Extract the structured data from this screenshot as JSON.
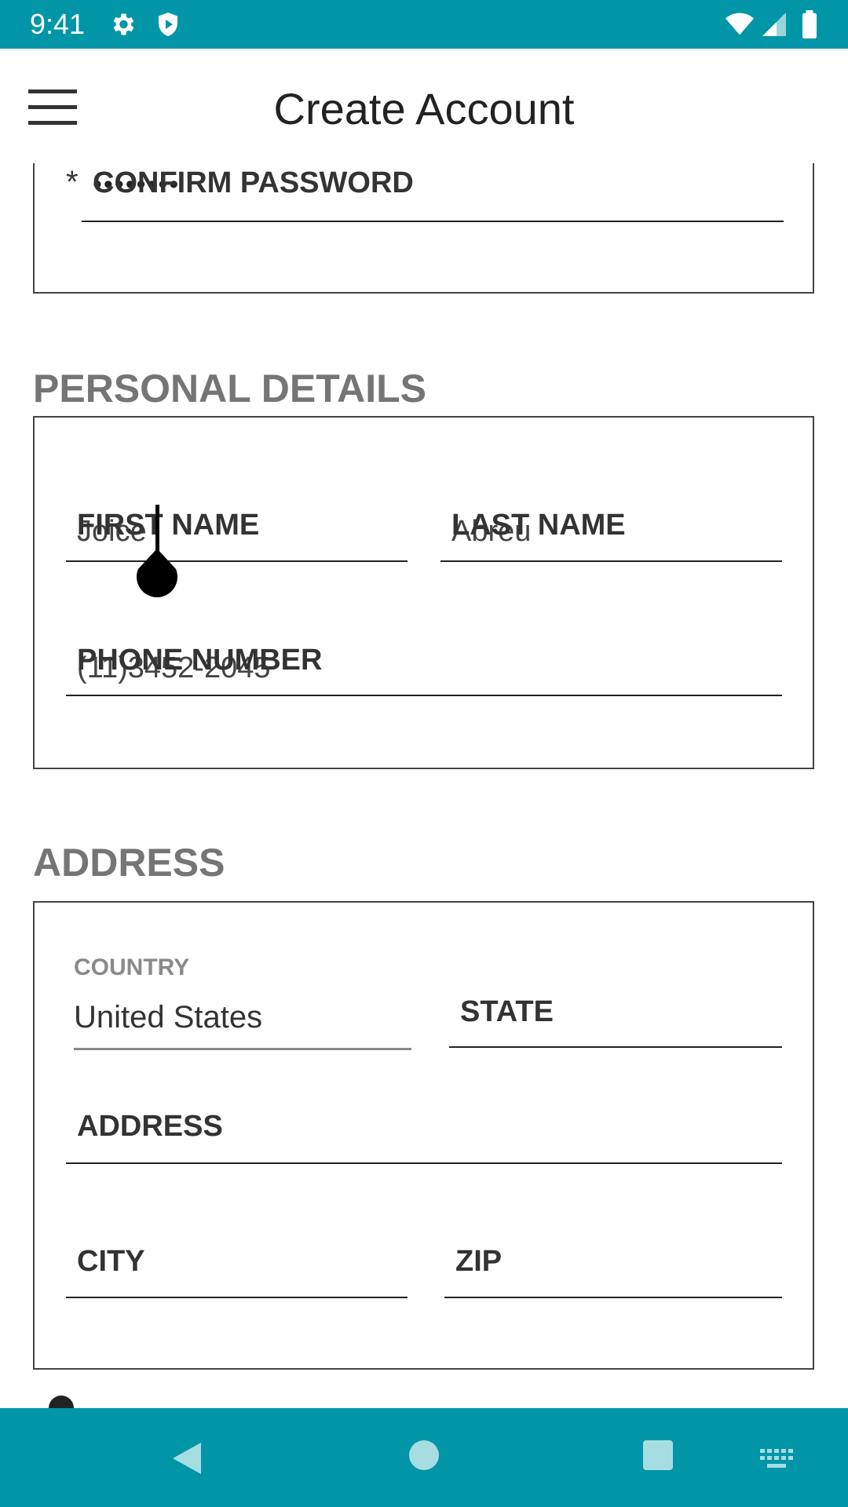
{
  "status_bar": {
    "time": "9:41",
    "icons": [
      "gear-icon",
      "shield-icon",
      "wifi-icon",
      "signal-icon",
      "battery-icon"
    ]
  },
  "app_bar": {
    "title": "Create Account",
    "menu_icon": "hamburger-menu-icon"
  },
  "account_section": {
    "confirm_password": {
      "required_marker": "*",
      "label": "CONFIRM PASSWORD",
      "value": "••••••••"
    }
  },
  "personal_details": {
    "title": "PERSONAL DETAILS",
    "first_name": {
      "label": "FIRST NAME",
      "value": "Joice"
    },
    "last_name": {
      "label": "LAST NAME",
      "value": "Abreu"
    },
    "phone_number": {
      "label": "PHONE NUMBER",
      "value": "(11)3452-2045"
    }
  },
  "address": {
    "title": "ADDRESS",
    "country": {
      "label": "COUNTRY",
      "value": "United States"
    },
    "state": {
      "label": "STATE"
    },
    "address": {
      "label": "ADDRESS"
    },
    "city": {
      "label": "CITY"
    },
    "zip": {
      "label": "ZIP"
    }
  },
  "nav_bar": {
    "icons": [
      "back-icon",
      "home-icon",
      "recents-icon",
      "keyboard-icon"
    ]
  },
  "colors": {
    "accent": "#0096a7",
    "section_title": "#757575"
  }
}
